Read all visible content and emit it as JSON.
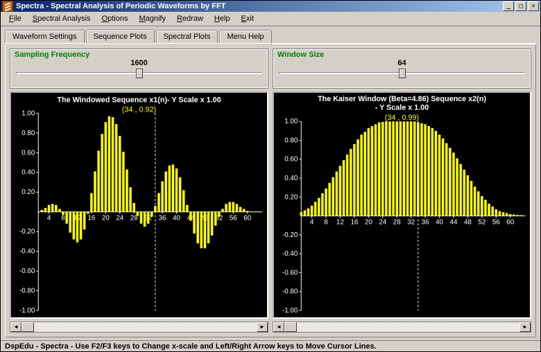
{
  "window": {
    "title": "Spectra - Spectral Analysis of Periodic Waveforms by FFT"
  },
  "menu": {
    "items": [
      {
        "label": "File",
        "u": 0
      },
      {
        "label": "Spectral Analysis",
        "u": 0
      },
      {
        "label": "Options",
        "u": 0
      },
      {
        "label": "Magnify",
        "u": 0
      },
      {
        "label": "Redraw",
        "u": 0
      },
      {
        "label": "Help",
        "u": 0
      },
      {
        "label": "Exit",
        "u": 0
      }
    ]
  },
  "tabs": {
    "items": [
      {
        "label": "Waveform Settings",
        "active": false
      },
      {
        "label": "Sequence Plots",
        "active": true
      },
      {
        "label": "Spectral Plots",
        "active": false
      },
      {
        "label": "Menu Help",
        "active": false
      }
    ]
  },
  "controls": {
    "sampling_freq": {
      "label": "Sampling Frequency",
      "value": "1600",
      "slider_pos": 0.5
    },
    "window_size": {
      "label": "Window Size",
      "value": "64",
      "slider_pos": 0.5
    }
  },
  "statusbar": "DspEdu - Spectra - Use F2/F3 keys to Change x-scale and Left/Right Arrow keys to Move Cursor Lines.",
  "chart_data": [
    {
      "type": "bar",
      "title": "The Windowed Sequence x1(n)- Y Scale x    1.00",
      "annotation": "(34 , 0.92)",
      "cursor_x": 34,
      "xlabel": "",
      "ylabel": "",
      "ylim": [
        -1.0,
        1.0
      ],
      "xlim": [
        1,
        64
      ],
      "x_ticks": [
        4,
        8,
        12,
        16,
        20,
        24,
        28,
        32,
        36,
        40,
        44,
        48,
        52,
        56,
        60
      ],
      "y_ticks": [
        -1.0,
        -0.8,
        -0.6,
        -0.4,
        -0.2,
        0.2,
        0.4,
        0.6,
        0.8,
        1.0
      ],
      "categories": [
        1,
        2,
        3,
        4,
        5,
        6,
        7,
        8,
        9,
        10,
        11,
        12,
        13,
        14,
        15,
        16,
        17,
        18,
        19,
        20,
        21,
        22,
        23,
        24,
        25,
        26,
        27,
        28,
        29,
        30,
        31,
        32,
        33,
        34,
        35,
        36,
        37,
        38,
        39,
        40,
        41,
        42,
        43,
        44,
        45,
        46,
        47,
        48,
        49,
        50,
        51,
        52,
        53,
        54,
        55,
        56,
        57,
        58,
        59,
        60,
        61,
        62,
        63,
        64
      ],
      "values": [
        0.0,
        0.02,
        0.04,
        0.07,
        0.08,
        0.07,
        0.03,
        -0.03,
        -0.12,
        -0.21,
        -0.28,
        -0.31,
        -0.28,
        -0.18,
        -0.02,
        0.19,
        0.41,
        0.62,
        0.79,
        0.91,
        0.97,
        0.96,
        0.89,
        0.77,
        0.61,
        0.43,
        0.25,
        0.09,
        -0.04,
        -0.12,
        -0.15,
        -0.12,
        -0.05,
        0.06,
        0.19,
        0.31,
        0.41,
        0.47,
        0.48,
        0.44,
        0.35,
        0.22,
        0.07,
        -0.09,
        -0.22,
        -0.32,
        -0.37,
        -0.37,
        -0.32,
        -0.24,
        -0.14,
        -0.05,
        0.03,
        0.08,
        0.1,
        0.1,
        0.08,
        0.05,
        0.03,
        0.01,
        0.0,
        0.0,
        0.0,
        0.0
      ]
    },
    {
      "type": "bar",
      "title": "The Kaiser Window (Beta=4.86) Sequence x2(n) - Y Scale x    1.00",
      "title_line1": "The Kaiser Window (Beta=4.86) Sequence x2(n)",
      "title_line2": "- Y Scale x    1.00",
      "annotation": "(34 , 0.99)",
      "cursor_x": 34,
      "xlabel": "",
      "ylabel": "",
      "ylim": [
        -1.0,
        1.0
      ],
      "xlim": [
        1,
        64
      ],
      "x_ticks": [
        4,
        8,
        12,
        16,
        20,
        24,
        28,
        32,
        36,
        40,
        44,
        48,
        52,
        56,
        60
      ],
      "y_ticks": [
        -1.0,
        -0.8,
        -0.6,
        -0.4,
        -0.2,
        0.2,
        0.4,
        0.6,
        0.8,
        1.0
      ],
      "categories": [
        1,
        2,
        3,
        4,
        5,
        6,
        7,
        8,
        9,
        10,
        11,
        12,
        13,
        14,
        15,
        16,
        17,
        18,
        19,
        20,
        21,
        22,
        23,
        24,
        25,
        26,
        27,
        28,
        29,
        30,
        31,
        32,
        33,
        34,
        35,
        36,
        37,
        38,
        39,
        40,
        41,
        42,
        43,
        44,
        45,
        46,
        47,
        48,
        49,
        50,
        51,
        52,
        53,
        54,
        55,
        56,
        57,
        58,
        59,
        60,
        61,
        62,
        63,
        64
      ],
      "values": [
        0.04,
        0.06,
        0.08,
        0.11,
        0.15,
        0.19,
        0.24,
        0.29,
        0.35,
        0.41,
        0.47,
        0.53,
        0.59,
        0.65,
        0.71,
        0.76,
        0.81,
        0.86,
        0.89,
        0.93,
        0.95,
        0.97,
        0.99,
        0.995,
        1.0,
        1.0,
        1.0,
        1.0,
        1.0,
        1.0,
        1.0,
        1.0,
        1.0,
        0.99,
        0.98,
        0.97,
        0.95,
        0.93,
        0.9,
        0.86,
        0.82,
        0.77,
        0.72,
        0.67,
        0.61,
        0.55,
        0.49,
        0.43,
        0.37,
        0.31,
        0.26,
        0.21,
        0.17,
        0.13,
        0.1,
        0.07,
        0.05,
        0.04,
        0.03,
        0.02,
        0.015,
        0.01,
        0.008,
        0.005
      ]
    }
  ]
}
